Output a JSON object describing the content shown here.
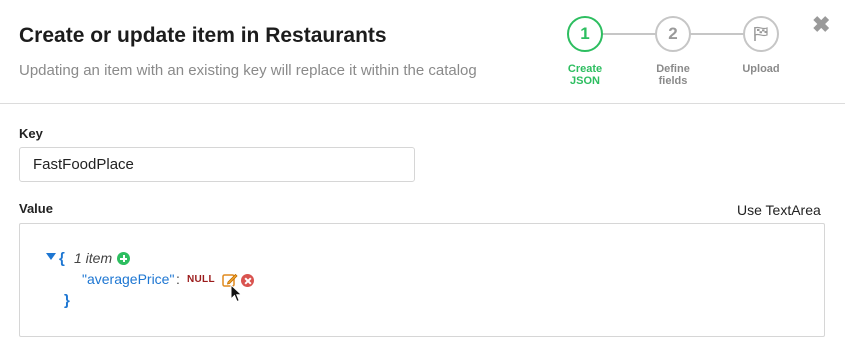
{
  "header": {
    "title": "Create or update item in Restaurants",
    "subtitle": "Updating an item with an existing key will replace it within the catalog"
  },
  "steps": [
    {
      "number": "1",
      "label": "Create JSON",
      "state": "active"
    },
    {
      "number": "2",
      "label": "Define fields",
      "state": "inactive"
    },
    {
      "number": "",
      "label": "Upload",
      "icon": "checkered-flag-icon",
      "state": "inactive"
    }
  ],
  "close_icon": "close-icon",
  "key": {
    "label": "Key",
    "value": "FastFoodPlace"
  },
  "value": {
    "label": "Value",
    "toggle_label": "Use TextArea",
    "json_editor": {
      "open_brace": "{",
      "count_label": "1 item",
      "close_brace": "}",
      "items": [
        {
          "key": "\"averagePrice\"",
          "separator": ":",
          "value": "NULL"
        }
      ]
    }
  },
  "colors": {
    "accent_green": "#2dbe60",
    "inactive_gray": "#c6c6c6",
    "json_key_blue": "#1d76d2",
    "null_red": "#9b1b1b",
    "remove_red": "#d9534f"
  }
}
